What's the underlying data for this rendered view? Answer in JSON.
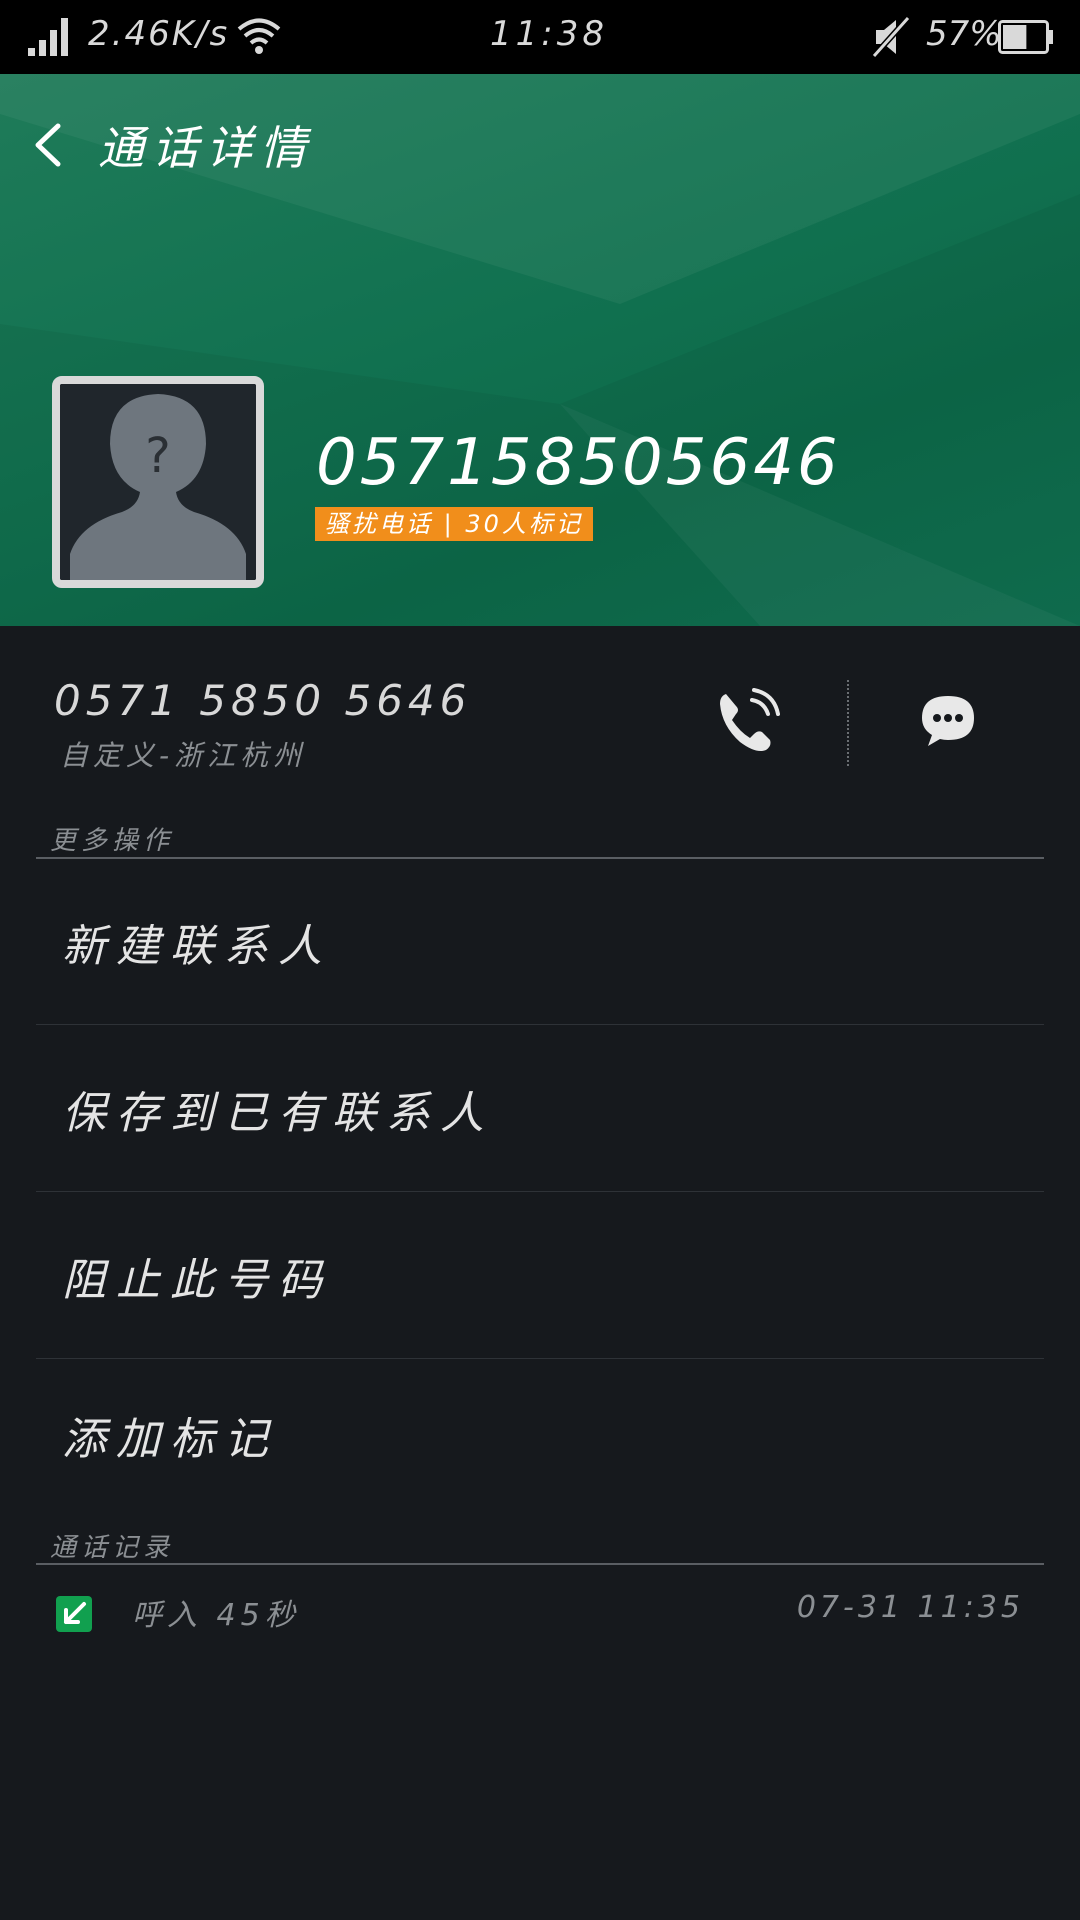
{
  "status_bar": {
    "net_speed": "2.46K/s",
    "time": "11:38",
    "battery_percent": "57%",
    "battery_level": 0.57,
    "icons": [
      "signal-icon",
      "wifi-icon",
      "mute-icon",
      "battery-icon"
    ]
  },
  "header": {
    "back_icon": "chevron-left-icon",
    "title": "通话详情",
    "phone_number": "057158505646",
    "spam_tag": "骚扰电话 | 30人标记",
    "colors": {
      "background": "#117150",
      "tag": "#f18e1b"
    }
  },
  "number_section": {
    "formatted_number": "0571 5850 5646",
    "location": "自定义-浙江杭州",
    "call_icon": "phone-call-icon",
    "message_icon": "message-icon"
  },
  "more_actions": {
    "label": "更多操作",
    "items": [
      {
        "label": "新建联系人"
      },
      {
        "label": "保存到已有联系人"
      },
      {
        "label": "阻止此号码"
      },
      {
        "label": "添加标记"
      }
    ]
  },
  "call_log": {
    "label": "通话记录",
    "entries": [
      {
        "icon": "incoming-call-icon",
        "type": "呼入 45秒",
        "time": "07-31 11:35"
      }
    ]
  }
}
